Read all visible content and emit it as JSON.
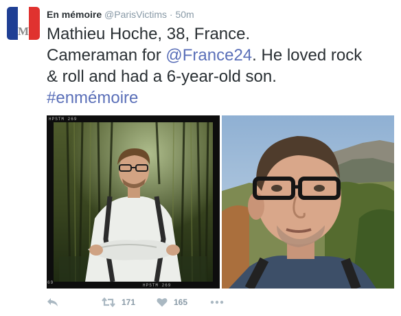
{
  "tweet": {
    "display_name": "En mémoire",
    "handle": "@ParisVictims",
    "separator": "·",
    "time": "50m",
    "avatar_letter": "M",
    "text_line1": "Mathieu Hoche, 38, France.",
    "text_line2_pre": "Cameraman for ",
    "mention": "@France24",
    "text_line2_post": ". He loved rock",
    "text_line3": "& roll and had a 6-year-old son.",
    "hashtag": "#enmémoire"
  },
  "photos": {
    "photo1_film_top": "HPSTM 269",
    "photo1_film_bottom": "HPSTM 269",
    "photo1_film_side": "69"
  },
  "actions": {
    "reply_icon": "reply-icon",
    "retweet_icon": "retweet-icon",
    "retweet_count": "171",
    "like_icon": "heart-icon",
    "like_count": "165",
    "more_icon": "more-icon"
  },
  "colors": {
    "flag_blue": "#1f3f94",
    "flag_white": "#ffffff",
    "flag_red": "#e0322f",
    "link": "#5a6fb8",
    "meta": "#8899a6"
  }
}
